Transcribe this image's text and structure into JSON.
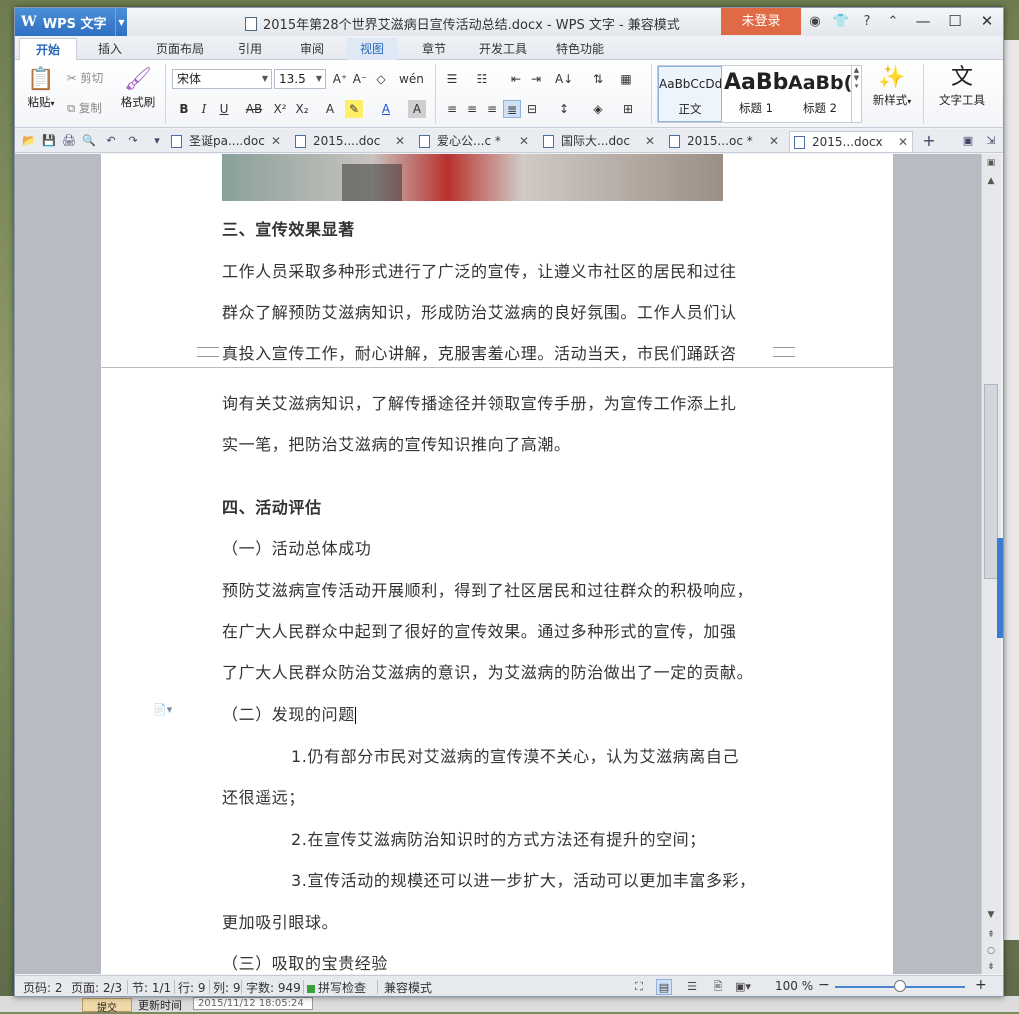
{
  "window": {
    "app_menu": "WPS 文字",
    "title": "2015年第28个世界艾滋病日宣传活动总结.docx - WPS 文字 - 兼容模式",
    "login": "未登录",
    "help_icon": "?"
  },
  "ribbon_tabs": [
    "开始",
    "插入",
    "页面布局",
    "引用",
    "审阅",
    "视图",
    "章节",
    "开发工具",
    "特色功能"
  ],
  "ribbon": {
    "paste": "粘贴",
    "cut": "剪切",
    "copy": "复制",
    "format_painter": "格式刷",
    "font_name": "宋体",
    "font_size": "13.5",
    "styles": [
      {
        "preview": "AaBbCcDd",
        "name": "正文"
      },
      {
        "preview": "AaBb",
        "name": "标题 1"
      },
      {
        "preview": "AaBb(",
        "name": "标题 2"
      }
    ],
    "new_style": "新样式",
    "text_tools": "文字工具"
  },
  "doc_tabs": [
    {
      "label": "圣诞pa....doc",
      "active": false
    },
    {
      "label": "2015....doc",
      "active": false
    },
    {
      "label": "爱心公...c *",
      "active": false
    },
    {
      "label": "国际大...doc",
      "active": false
    },
    {
      "label": "2015...oc *",
      "active": false
    },
    {
      "label": "2015...docx",
      "active": true
    }
  ],
  "document": {
    "page1_lines": [
      "三、宣传效果显著",
      "工作人员采取多种形式进行了广泛的宣传，让遵义市社区的居民和过往",
      "群众了解预防艾滋病知识，形成防治艾滋病的良好氛围。工作人员们认",
      "真投入宣传工作，耐心讲解，克服害羞心理。活动当天，市民们踊跃咨"
    ],
    "page2_lines": [
      "询有关艾滋病知识，了解传播途径并领取宣传手册，为宣传工作添上扎",
      "实一笔，把防治艾滋病的宣传知识推向了高潮。",
      "四、活动评估",
      "（一）活动总体成功",
      "预防艾滋病宣传活动开展顺利，得到了社区居民和过往群众的积极响应，",
      "在广大人民群众中起到了很好的宣传效果。通过多种形式的宣传，加强",
      "了广大人民群众防治艾滋病的意识，为艾滋病的防治做出了一定的贡献。",
      "（二）发现的问题",
      "1.仍有部分市民对艾滋病的宣传漠不关心，认为艾滋病离自己",
      "还很遥远；",
      "2.在宣传艾滋病防治知识时的方式方法还有提升的空间；",
      "3.宣传活动的规模还可以进一步扩大，活动可以更加丰富多彩，",
      "更加吸引眼球。",
      "（三）吸取的宝贵经验"
    ]
  },
  "status": {
    "page_code": "页码: 2",
    "page": "页面: 2/3",
    "section": "节: 1/1",
    "row": "行: 9",
    "col": "列: 9",
    "word_count": "字数: 949",
    "spell": "拼写检查",
    "compat": "兼容模式",
    "zoom": "100 %",
    "zoom_level": 0.5
  },
  "desktop": {
    "taskbar_tab": "提交",
    "taskbar_label": "更新时间",
    "taskbar_value": "2015/11/12 18:05:24"
  }
}
